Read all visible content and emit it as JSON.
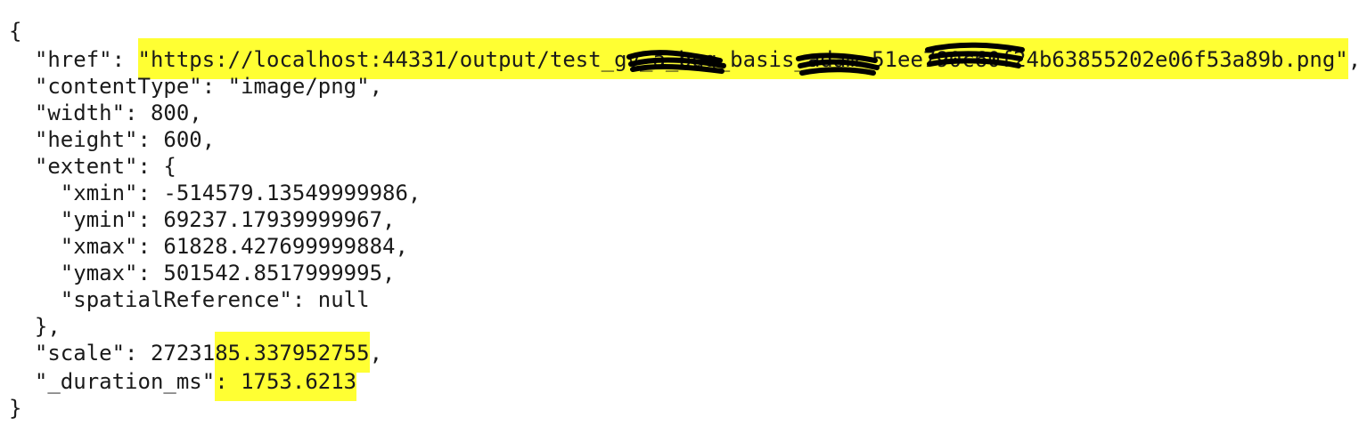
{
  "json_lines": {
    "open": "{",
    "href_indent": "  ",
    "href_key": "\"href\": ",
    "href_value": "\"https://localhost:44331/output/test_gv_a_bug_basis_adam_51ee790c60f24b63855202e06f53a89b.png\"",
    "href_tail": ",",
    "content_type": "  \"contentType\": \"image/png\",",
    "width": "  \"width\": 800,",
    "height": "  \"height\": 600,",
    "extent_open": "  \"extent\": {",
    "xmin": "    \"xmin\": -514579.13549999986,",
    "ymin": "    \"ymin\": 69237.17939999967,",
    "xmax": "    \"xmax\": 61828.427699999884,",
    "ymax": "    \"ymax\": 501542.8517999995,",
    "spatial_reference": "    \"spatialReference\": null",
    "extent_close": "  },",
    "scale_prefix": "  \"scale\": 27231",
    "scale_highlight": "85.337952755",
    "scale_tail": ",",
    "duration_prefix": "  \"_duration_ms\"",
    "duration_highlight": ": 1753.6213",
    "close": "}"
  },
  "colors": {
    "highlight": "#ffff33",
    "text": "#1a1a1a",
    "redaction": "#000000"
  }
}
